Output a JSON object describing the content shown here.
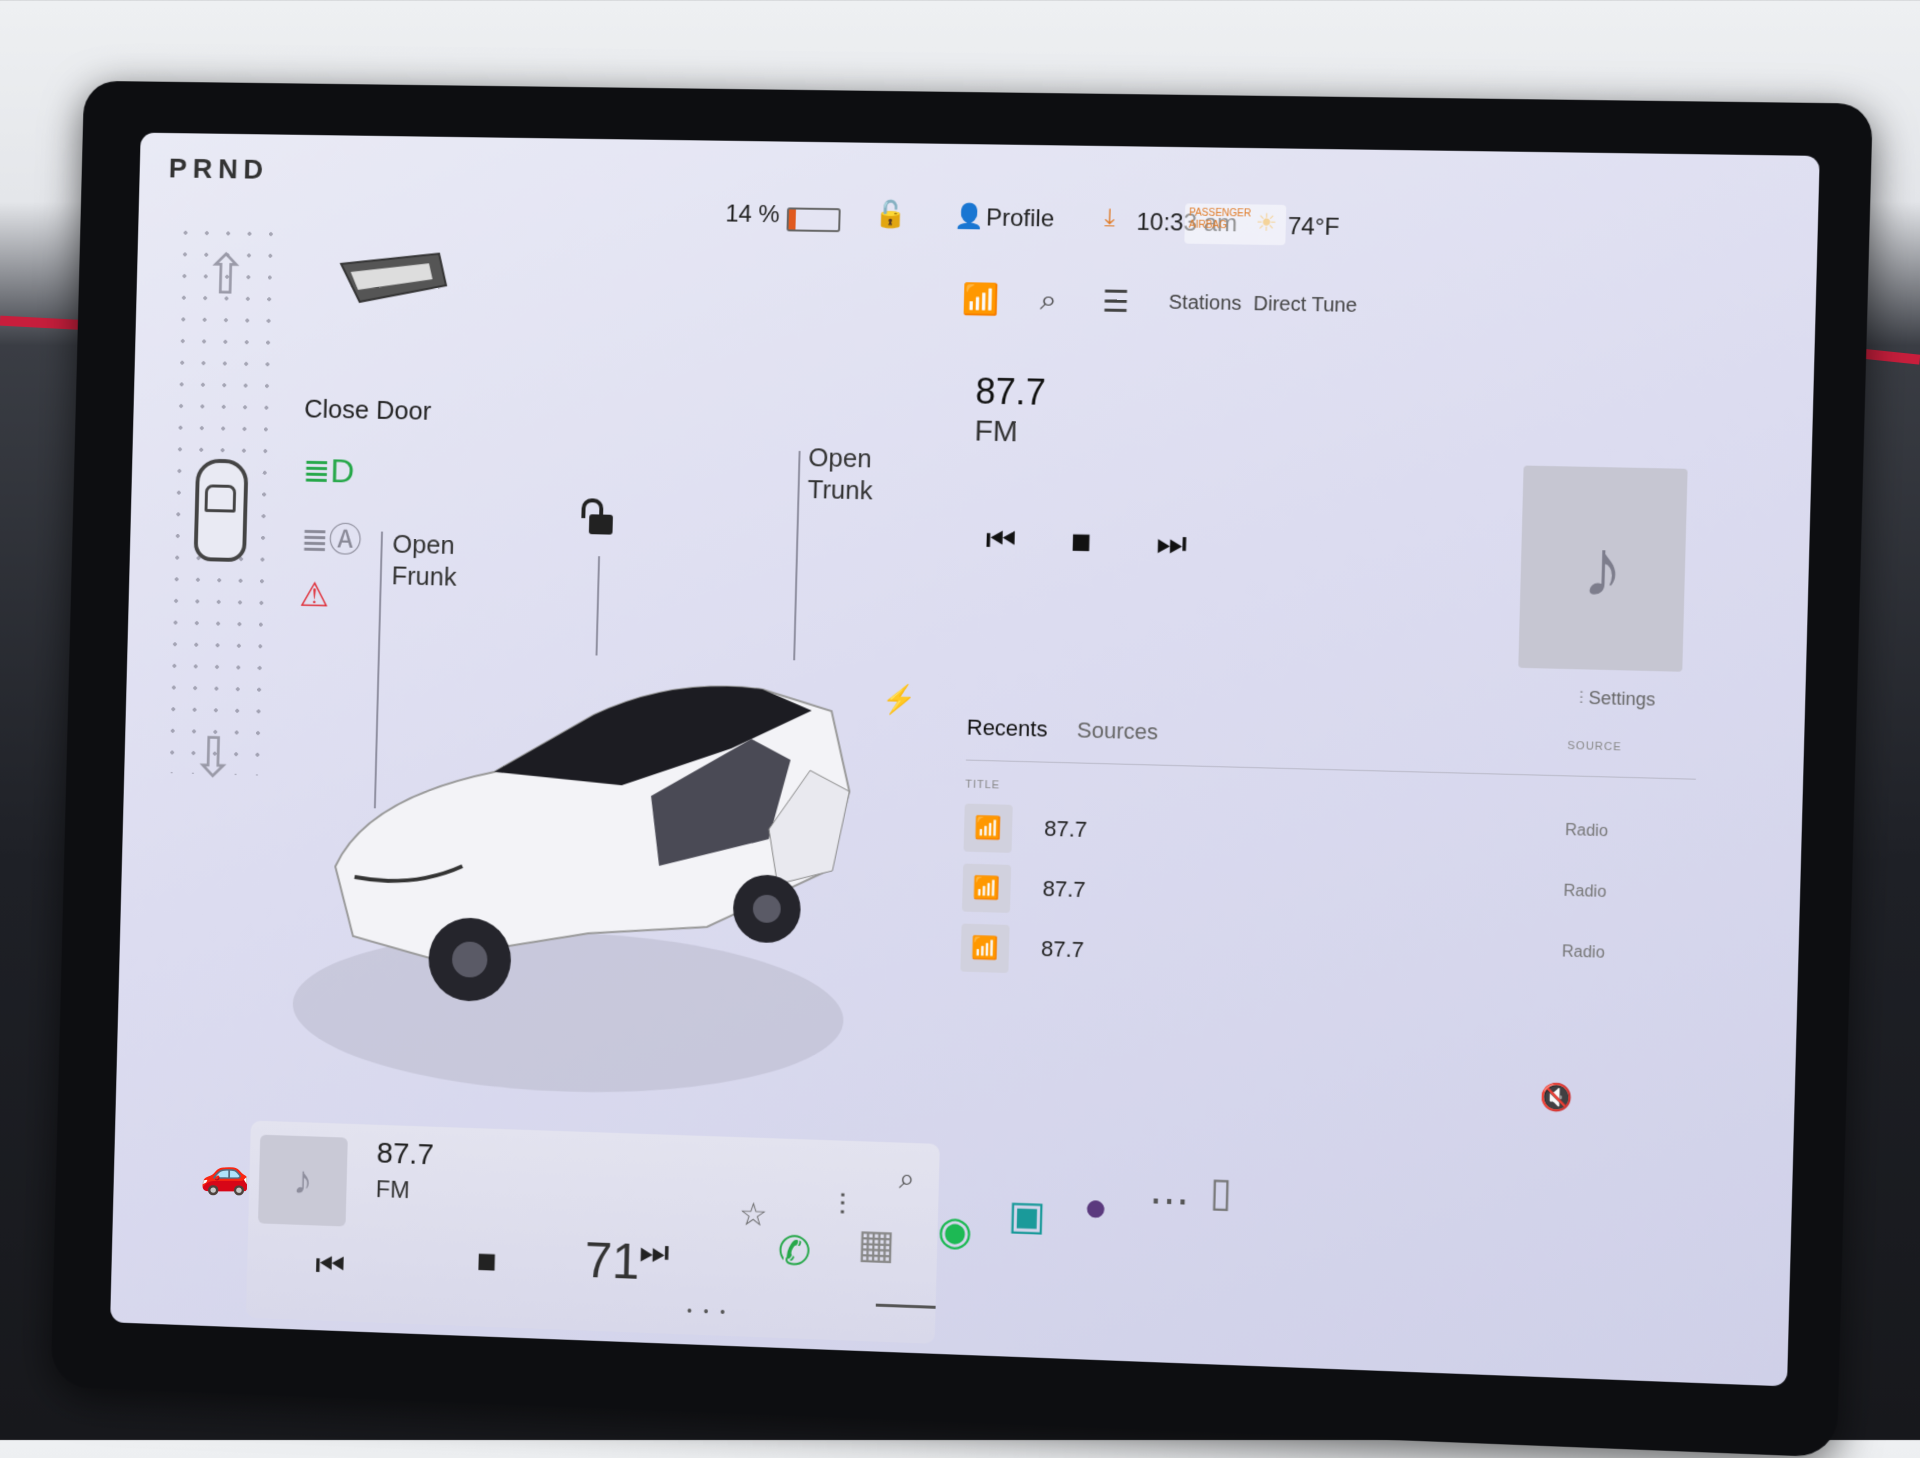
{
  "gear": {
    "prnd": "PRND"
  },
  "vehicle": {
    "close_door": "Close Door",
    "open_frunk": "Open\nFrunk",
    "open_trunk": "Open\nTrunk"
  },
  "status": {
    "battery_pct": "14 %",
    "battery_level": 0.14,
    "profile": "Profile",
    "time": "10:33 am",
    "temp": "74°F",
    "airbag": "PASSENGER AIRBAG"
  },
  "media": {
    "tabs": {
      "stations": "Stations",
      "direct": "Direct Tune"
    },
    "now": {
      "freq": "87.7",
      "band": "FM"
    },
    "settings": "Settings",
    "list_tabs": {
      "recents": "Recents",
      "sources": "Sources"
    },
    "columns": {
      "title": "TITLE",
      "source": "SOURCE"
    },
    "rows": [
      {
        "title": "87.7",
        "source": "Radio"
      },
      {
        "title": "87.7",
        "source": "Radio"
      },
      {
        "title": "87.7",
        "source": "Radio"
      }
    ]
  },
  "mini_player": {
    "freq": "87.7",
    "band": "FM"
  },
  "dock": {
    "speed": "71"
  },
  "colors": {
    "accent_red": "#e0313b",
    "green": "#27a84a",
    "battery": "#e05a1f"
  },
  "icons": [
    "music-note-icon",
    "search-icon",
    "filter-icon",
    "prev-icon",
    "stop-icon",
    "next-icon",
    "star-icon",
    "equalizer-icon",
    "phone-icon",
    "spotify-icon",
    "mute-icon",
    "lock-icon"
  ]
}
